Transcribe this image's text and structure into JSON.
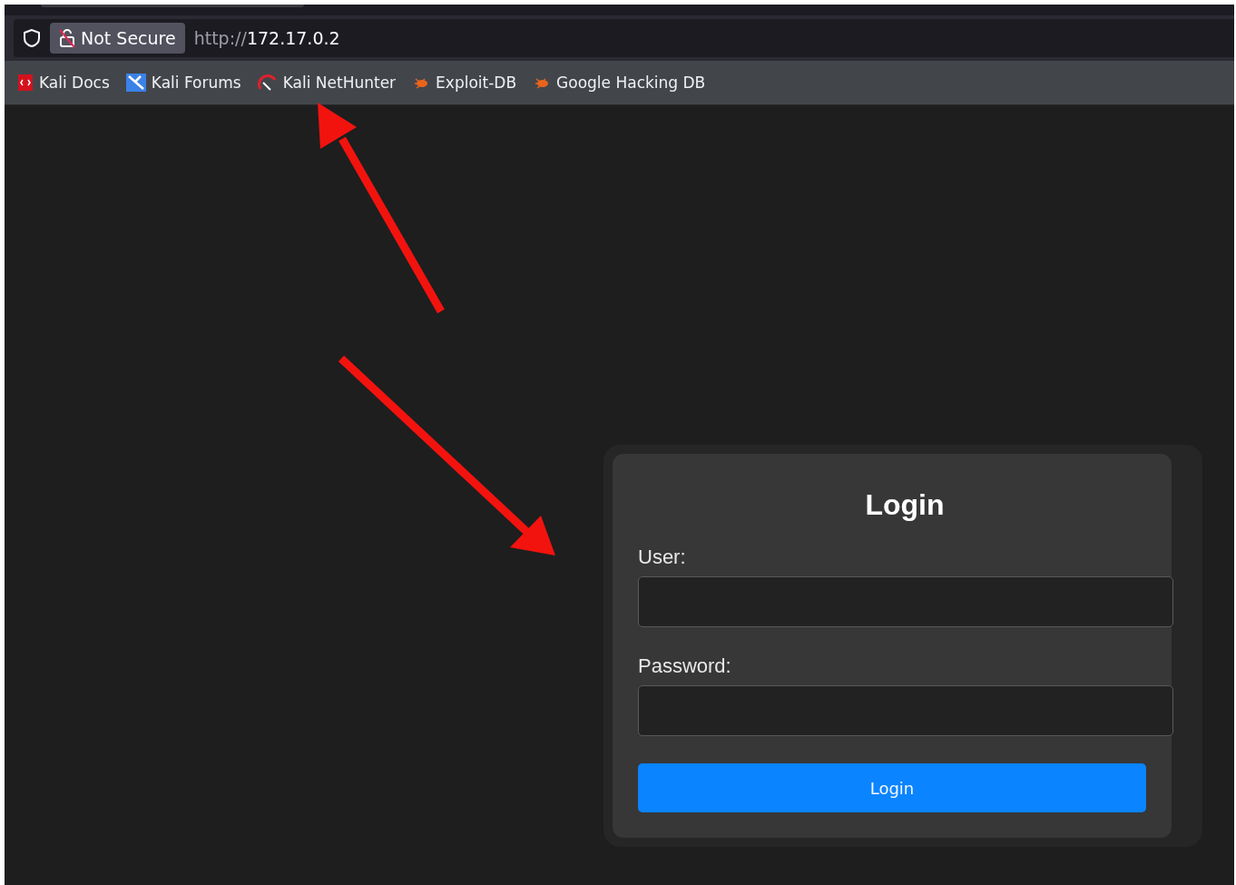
{
  "address_bar": {
    "security_label": "Not Secure",
    "url_scheme": "http://",
    "url_host": "172.17.0.2"
  },
  "bookmarks": [
    {
      "label": "Kali Docs",
      "kind": "docs"
    },
    {
      "label": "Kali Forums",
      "kind": "forums"
    },
    {
      "label": "Kali NetHunter",
      "kind": "nethunter"
    },
    {
      "label": "Exploit-DB",
      "kind": "bug"
    },
    {
      "label": "Google Hacking DB",
      "kind": "bug"
    }
  ],
  "login_form": {
    "title": "Login",
    "fields": [
      {
        "label": "User:"
      },
      {
        "label": "Password:"
      }
    ],
    "submit": "Login"
  }
}
